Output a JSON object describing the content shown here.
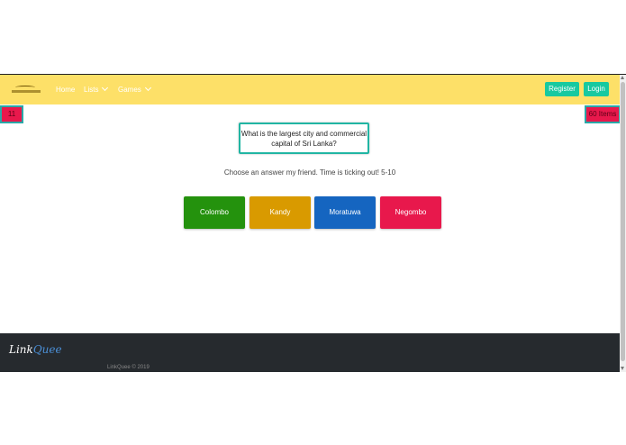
{
  "nav": {
    "home": "Home",
    "lists": "Lists",
    "games": "Games",
    "register": "Register",
    "login": "Login"
  },
  "score_badge": "11",
  "timer_badge": "60 Items",
  "question": "What is the largest city and commercial capital of Sri Lanka?",
  "prompt": "Choose an answer my friend. Time is ticking out! 5-10",
  "answers": [
    {
      "label": "Colombo",
      "color": "#24920d"
    },
    {
      "label": "Kandy",
      "color": "#d99a00"
    },
    {
      "label": "Moratuwa",
      "color": "#1565c0"
    },
    {
      "label": "Negombo",
      "color": "#e8184c"
    }
  ],
  "footer": {
    "logo_part1": "Link",
    "logo_part2": "Quee",
    "copyright": "LinkQuee © 2019"
  },
  "colors": {
    "navbar": "#fde068",
    "accent": "#17c9a0",
    "footer": "#262a2e"
  }
}
